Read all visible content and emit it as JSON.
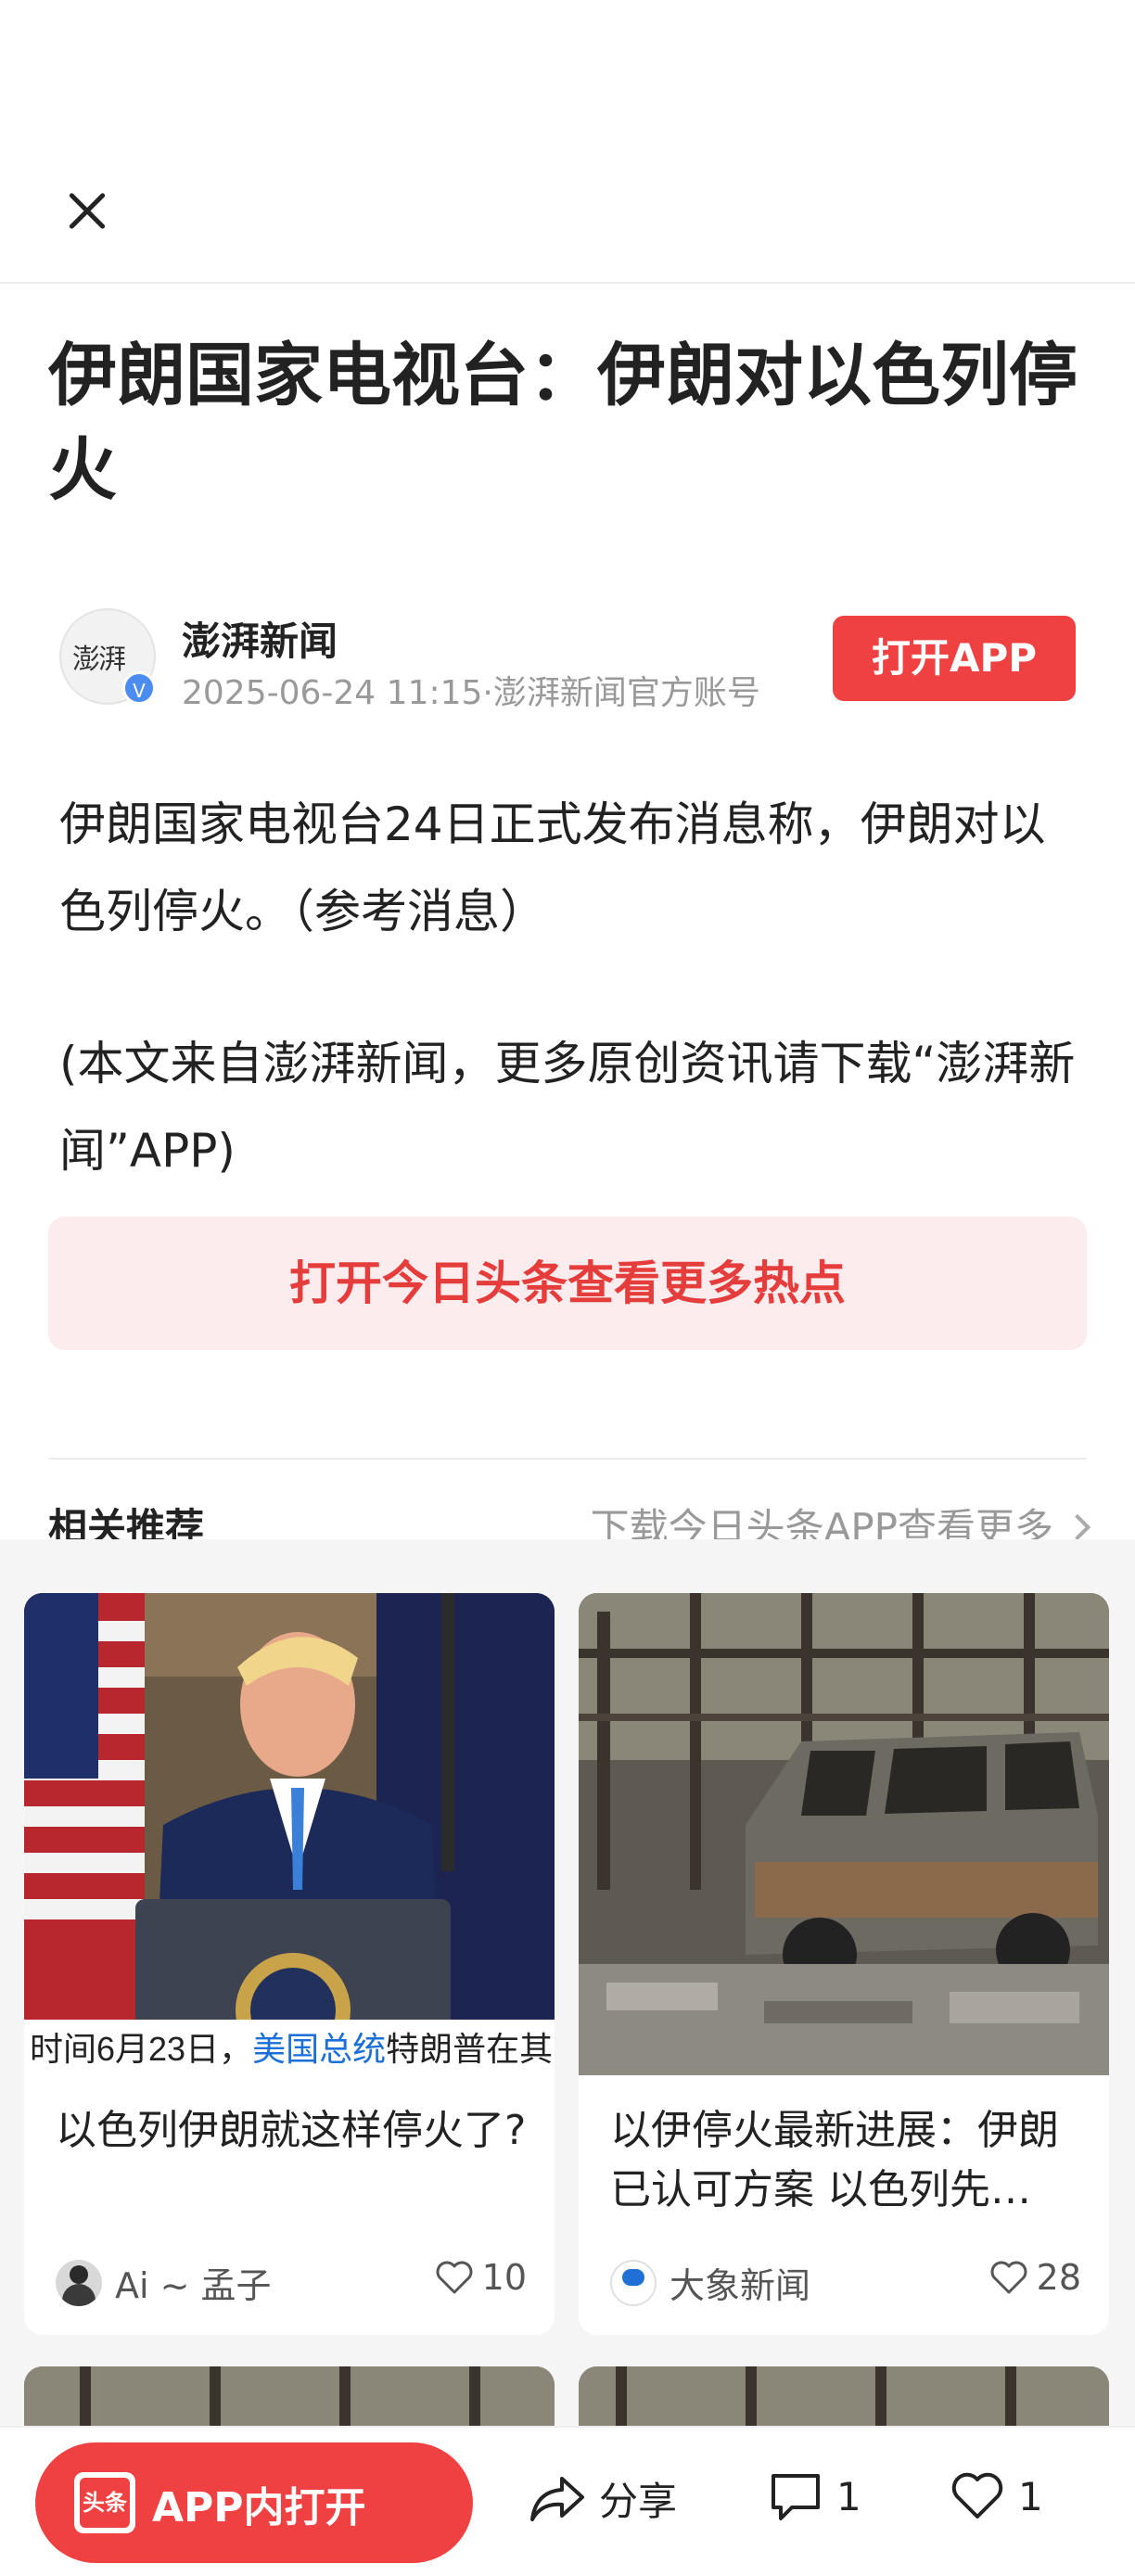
{
  "article": {
    "title": "伊朗国家电视台：伊朗对以色列停火",
    "author": "澎湃新闻",
    "avatar_text": "澎湃",
    "meta": "2025-06-24 11:15·澎湃新闻官方账号",
    "open_app_label": "打开APP",
    "paragraphs": [
      "伊朗国家电视台24日正式发布消息称，伊朗对以色列停火。（参考消息）",
      "(本文来自澎湃新闻，更多原创资讯请下载“澎湃新闻”APP)"
    ],
    "hot_banner": "打开今日头条查看更多热点"
  },
  "recommend": {
    "title": "相关推荐",
    "more": "下载今日头条APP查看更多",
    "cards": [
      {
        "image_caption": "时间6月23日，美国总统特朗普在其",
        "image_caption_parts": [
          "时间6月23日，",
          "美国总统",
          "特朗普在其"
        ],
        "title": "以色列伊朗就这样停火了?",
        "source": "Ai ~ 孟子",
        "likes": "10"
      },
      {
        "title": "以伊停火最新进展：伊朗已认可方案 以色列先…",
        "source": "大象新闻",
        "source_logo_text": "大象新闻",
        "likes": "28"
      }
    ]
  },
  "bottom_bar": {
    "app_logo_text": "头条",
    "open_in_app": "APP内打开",
    "share": "分享",
    "comments": "1",
    "likes": "1"
  },
  "colors": {
    "brand_red": "#f04142",
    "banner_bg": "#fdeced",
    "banner_text": "#e53c3c",
    "caption_blue": "#1a6fd8"
  },
  "icons": [
    "close-icon",
    "verified-icon",
    "chevron-right-icon",
    "heart-icon",
    "share-icon",
    "comment-icon"
  ]
}
